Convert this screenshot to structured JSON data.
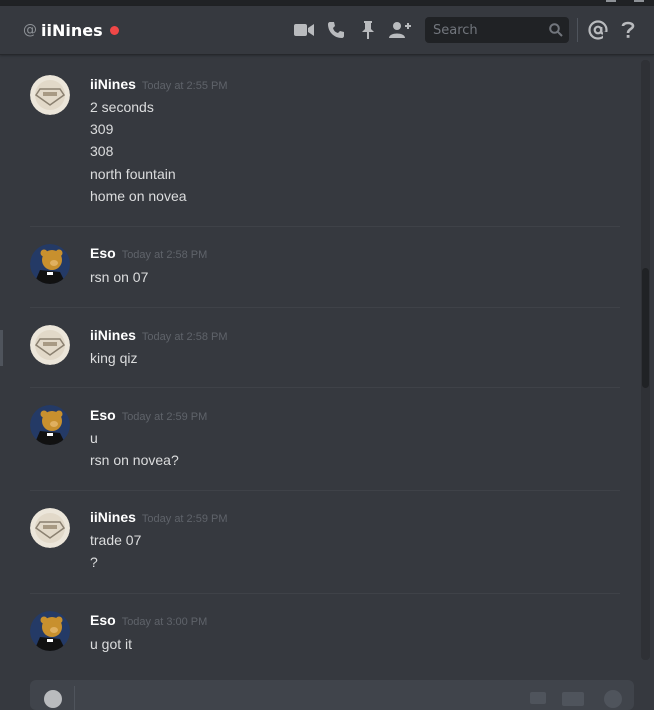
{
  "header": {
    "at_symbol": "@",
    "channel_name": "iiNines",
    "status_color": "#f04747",
    "icons": [
      "video-call-icon",
      "voice-call-icon",
      "pin-icon",
      "add-friend-icon"
    ],
    "search_placeholder": "Search"
  },
  "messages": [
    {
      "author": "iiNines",
      "timestamp": "Today at 2:55 PM",
      "avatar": "diamond-badge-avatar",
      "lines": [
        "2 seconds",
        "309",
        "308",
        "north fountain",
        "home on novea"
      ]
    },
    {
      "author": "Eso",
      "timestamp": "Today at 2:58 PM",
      "avatar": "bear-avatar",
      "lines": [
        "rsn on 07"
      ]
    },
    {
      "author": "iiNines",
      "timestamp": "Today at 2:58 PM",
      "avatar": "diamond-badge-avatar",
      "lines": [
        "king qiz"
      ]
    },
    {
      "author": "Eso",
      "timestamp": "Today at 2:59 PM",
      "avatar": "bear-avatar",
      "lines": [
        "u",
        "rsn on novea?"
      ]
    },
    {
      "author": "iiNines",
      "timestamp": "Today at 2:59 PM",
      "avatar": "diamond-badge-avatar",
      "lines": [
        "trade 07",
        "?"
      ]
    },
    {
      "author": "Eso",
      "timestamp": "Today at 3:00 PM",
      "avatar": "bear-avatar",
      "lines": [
        "u got it"
      ]
    }
  ]
}
